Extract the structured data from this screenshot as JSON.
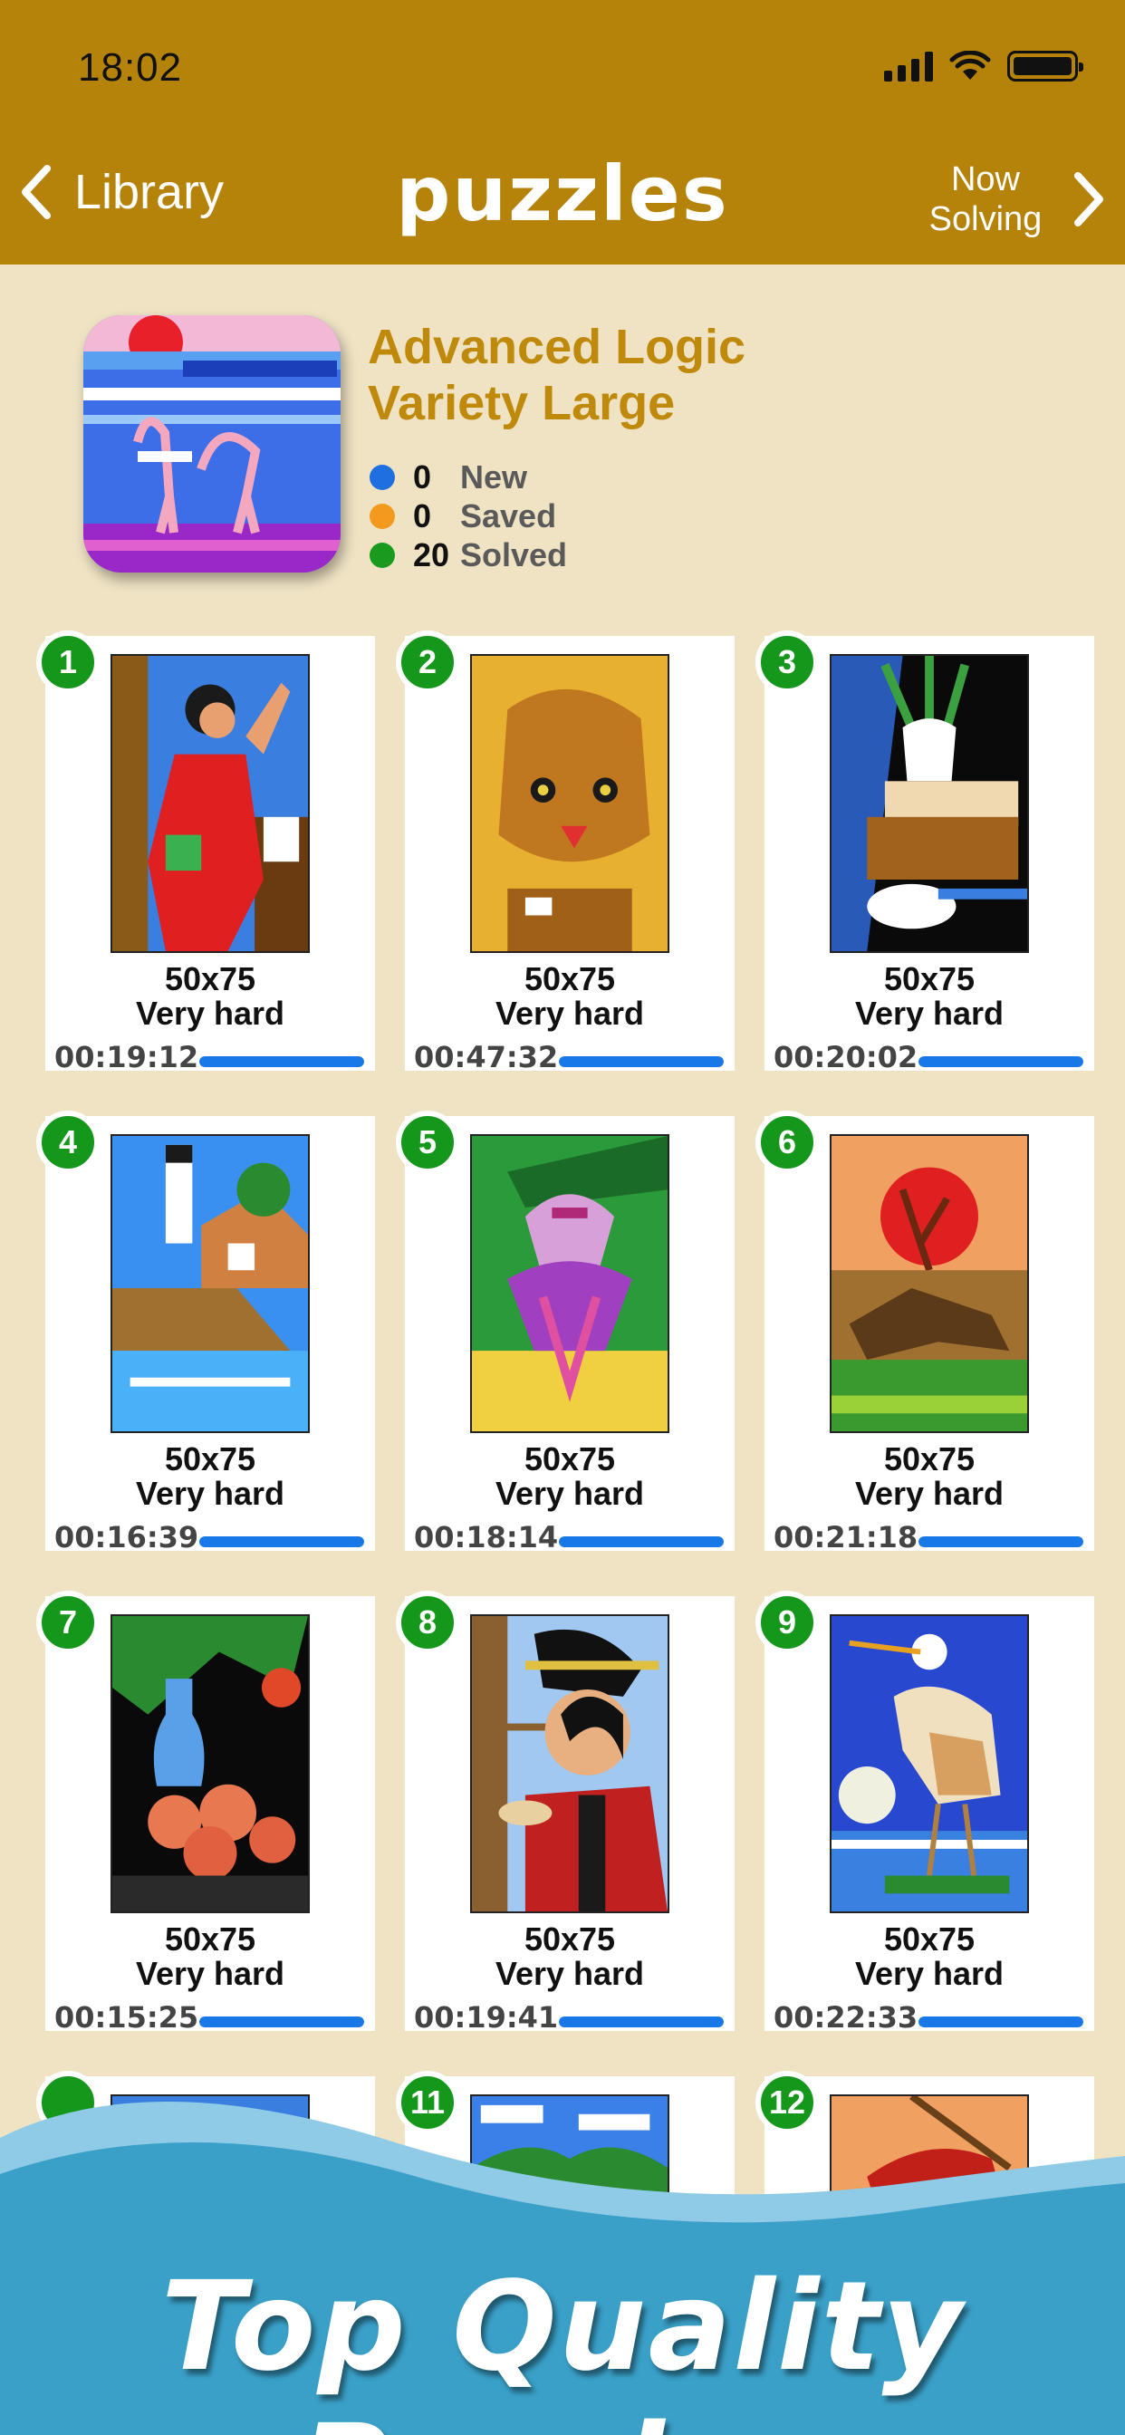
{
  "status_bar": {
    "time": "18:02"
  },
  "nav": {
    "back_label": "Library",
    "title": "puzzles",
    "forward_label": "Now Solving"
  },
  "pack": {
    "title": "Advanced Logic Variety Large",
    "stats": [
      {
        "count": "0",
        "label": "New",
        "color": "#1f6fe0"
      },
      {
        "count": "0",
        "label": "Saved",
        "color": "#f39a1e"
      },
      {
        "count": "20",
        "label": "Solved",
        "color": "#1a9b1f"
      }
    ]
  },
  "puzzles": [
    {
      "number": "1",
      "size": "50x75",
      "difficulty": "Very hard",
      "time": "00:19:12",
      "progress": 1.0,
      "subject": "flamenco dancer"
    },
    {
      "number": "2",
      "size": "50x75",
      "difficulty": "Very hard",
      "time": "00:47:32",
      "progress": 1.0,
      "subject": "lion"
    },
    {
      "number": "3",
      "size": "50x75",
      "difficulty": "Very hard",
      "time": "00:20:02",
      "progress": 1.0,
      "subject": "still life vase and cup"
    },
    {
      "number": "4",
      "size": "50x75",
      "difficulty": "Very hard",
      "time": "00:16:39",
      "progress": 1.0,
      "subject": "lighthouse cottage"
    },
    {
      "number": "5",
      "size": "50x75",
      "difficulty": "Very hard",
      "time": "00:18:14",
      "progress": 1.0,
      "subject": "fuchsia flowers"
    },
    {
      "number": "6",
      "size": "50x75",
      "difficulty": "Very hard",
      "time": "00:21:18",
      "progress": 1.0,
      "subject": "hare at sunset"
    },
    {
      "number": "7",
      "size": "50x75",
      "difficulty": "Very hard",
      "time": "00:15:25",
      "progress": 1.0,
      "subject": "apples and bottle"
    },
    {
      "number": "8",
      "size": "50x75",
      "difficulty": "Very hard",
      "time": "00:19:41",
      "progress": 1.0,
      "subject": "geisha with tea"
    },
    {
      "number": "9",
      "size": "50x75",
      "difficulty": "Very hard",
      "time": "00:22:33",
      "progress": 1.0,
      "subject": "egret"
    },
    {
      "number": "11",
      "subject": "landscape"
    },
    {
      "number": "12",
      "subject": "red bird"
    }
  ],
  "promo": {
    "text": "Top Quality Puzzles"
  },
  "colors": {
    "nav_bar": "#b5820a",
    "background": "#efe3c4",
    "badge": "#15971b",
    "progress": "#1878e8",
    "title": "#bf8a0c",
    "wave": "#3aa0c8"
  }
}
